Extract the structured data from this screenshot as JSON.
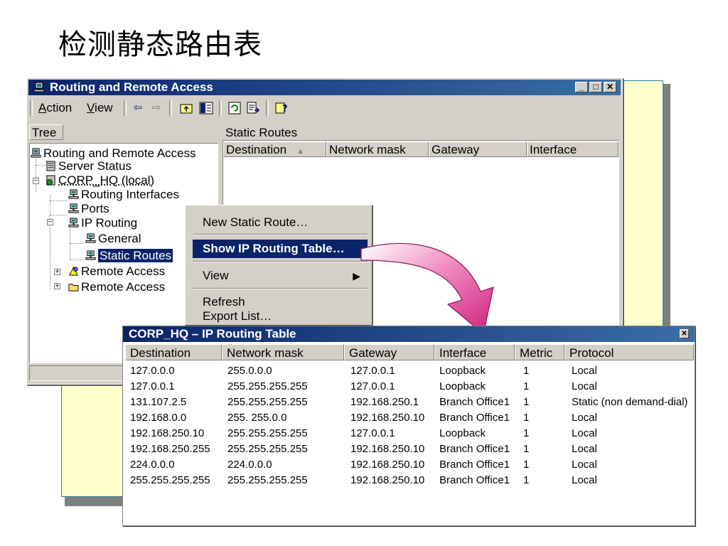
{
  "slide": {
    "title": "检测静态路由表"
  },
  "window": {
    "title": "Routing and Remote Access",
    "menu": [
      {
        "label": "Action",
        "accel": "A",
        "rest": "ction"
      },
      {
        "label": "View",
        "accel": "V",
        "rest": "iew"
      }
    ],
    "toolbar_icons": [
      "back-arrow-icon",
      "forward-arrow-icon",
      "up-folder-icon",
      "show-tree-icon",
      "refresh-icon",
      "export-list-icon",
      "help-icon"
    ],
    "tree_header": "Tree",
    "list_header": "Static Routes",
    "columns": [
      "Destination",
      "Network mask",
      "Gateway",
      "Interface"
    ]
  },
  "tree": [
    {
      "label": "Routing and Remote Access",
      "icon": "rras-server-icon"
    },
    {
      "label": "Server Status",
      "icon": "server-status-icon"
    },
    {
      "label": "CORP_HQ (local)",
      "icon": "server-running-icon"
    },
    {
      "label": "Routing Interfaces",
      "icon": "routing-icon"
    },
    {
      "label": "Ports",
      "icon": "routing-icon"
    },
    {
      "label": "IP Routing",
      "icon": "routing-icon"
    },
    {
      "label": "General",
      "icon": "routing-icon"
    },
    {
      "label": "Static Routes",
      "icon": "routing-icon"
    },
    {
      "label": "Remote Access",
      "icon": "remote-access-policy-icon"
    },
    {
      "label": "Remote Access",
      "icon": "folder-icon"
    }
  ],
  "context_menu": {
    "items": [
      "New Static Route…",
      "Show IP Routing Table…",
      "View",
      "Refresh",
      "Export List…"
    ],
    "highlighted": "Show IP Routing Table…"
  },
  "routing_table": {
    "title": "CORP_HQ – IP Routing Table",
    "columns": [
      "Destination",
      "Network mask",
      "Gateway",
      "Interface",
      "Metric",
      "Protocol"
    ],
    "rows": [
      [
        "127.0.0.0",
        "255.0.0.0",
        "127.0.0.1",
        "Loopback",
        "1",
        "Local"
      ],
      [
        "127.0.0.1",
        "255.255.255.255",
        "127.0.0.1",
        "Loopback",
        "1",
        "Local"
      ],
      [
        "131.107.2.5",
        "255.255.255.255",
        "192.168.250.1",
        "Branch Office1",
        "1",
        "Static (non demand-dial)"
      ],
      [
        "192.168.0.0",
        "255. 255.0.0",
        "192.168.250.10",
        "Branch Office1",
        "1",
        "Local"
      ],
      [
        "192.168.250.10",
        "255.255.255.255",
        "127.0.0.1",
        "Loopback",
        "1",
        "Local"
      ],
      [
        "192.168.250.255",
        "255.255.255.255",
        "192.168.250.10",
        "Branch Office1",
        "1",
        "Local"
      ],
      [
        "224.0.0.0",
        "224.0.0.0",
        "192.168.250.10",
        "Branch Office1",
        "1",
        "Local"
      ],
      [
        "255.255.255.255",
        "255.255.255.255",
        "192.168.250.10",
        "Branch Office1",
        "1",
        "Local"
      ]
    ]
  },
  "colors": {
    "titlebar": "#0a246a",
    "note_bg": "#ffffcc",
    "arrow": "#e0368c",
    "window_face": "#d4d0c8"
  }
}
